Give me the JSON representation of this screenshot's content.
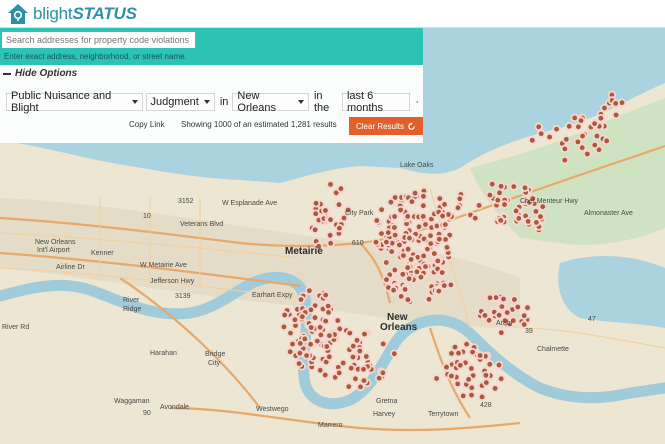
{
  "app": {
    "logo_text_light": "blight",
    "logo_text_bold": "STATUS",
    "brand_color": "#2c92a6",
    "accent_color": "#2cc3b5",
    "button_color": "#e2612a"
  },
  "search": {
    "placeholder": "Search addresses for property code violations",
    "help_text": "Enter exact address, neighborhood, or street name."
  },
  "options": {
    "toggle_label": "Hide Options",
    "violation_type": "Public Nuisance and Blight",
    "status": "Judgment",
    "word_in": "in",
    "location": "New Orleans",
    "word_the": "in the",
    "time_range": "last 6 months",
    "trailing": "·",
    "copy_link": "Copy Link",
    "results_text": "Showing 1000 of an estimated 1,281 results",
    "clear_label": "Clear Results"
  },
  "map": {
    "labels": {
      "lake_oaks": "Lake Oaks",
      "city_park": "City Park",
      "metairie": "Metairie",
      "new_orleans_1": "New",
      "new_orleans_2": "Orleans",
      "kenner": "Kenner",
      "river_ridge_1": "River",
      "river_ridge_2": "Ridge",
      "harahan": "Harahan",
      "bridge_city_1": "Bridge",
      "bridge_city_2": "City",
      "chalmette": "Chalmette",
      "arabi": "Arabi",
      "waggaman": "Waggaman",
      "avondale": "Avondale",
      "westwego": "Westwego",
      "marrero": "Marrero",
      "gretna": "Gretna",
      "harvey": "Harvey",
      "terrytown": "Terrytown",
      "airport_1": "New Orleans",
      "airport_2": "Int'l Airport",
      "veterans": "Veterans Blvd",
      "w_esplanade": "W Esplanade Ave",
      "w_metairie": "W Metairie Ave",
      "airline": "Airline Dr",
      "jefferson_hwy": "Jefferson Hwy",
      "river_rd": "River Rd",
      "earhart": "Earhart Expy",
      "chef": "Chef Menteur Hwy",
      "almonaster": "Almonaster Ave",
      "hwy_10": "10",
      "hwy_610": "610",
      "hwy_3152": "3152",
      "hwy_3139": "3139",
      "hwy_90": "90",
      "hwy_428": "428",
      "hwy_47": "47",
      "hwy_39": "39"
    }
  }
}
